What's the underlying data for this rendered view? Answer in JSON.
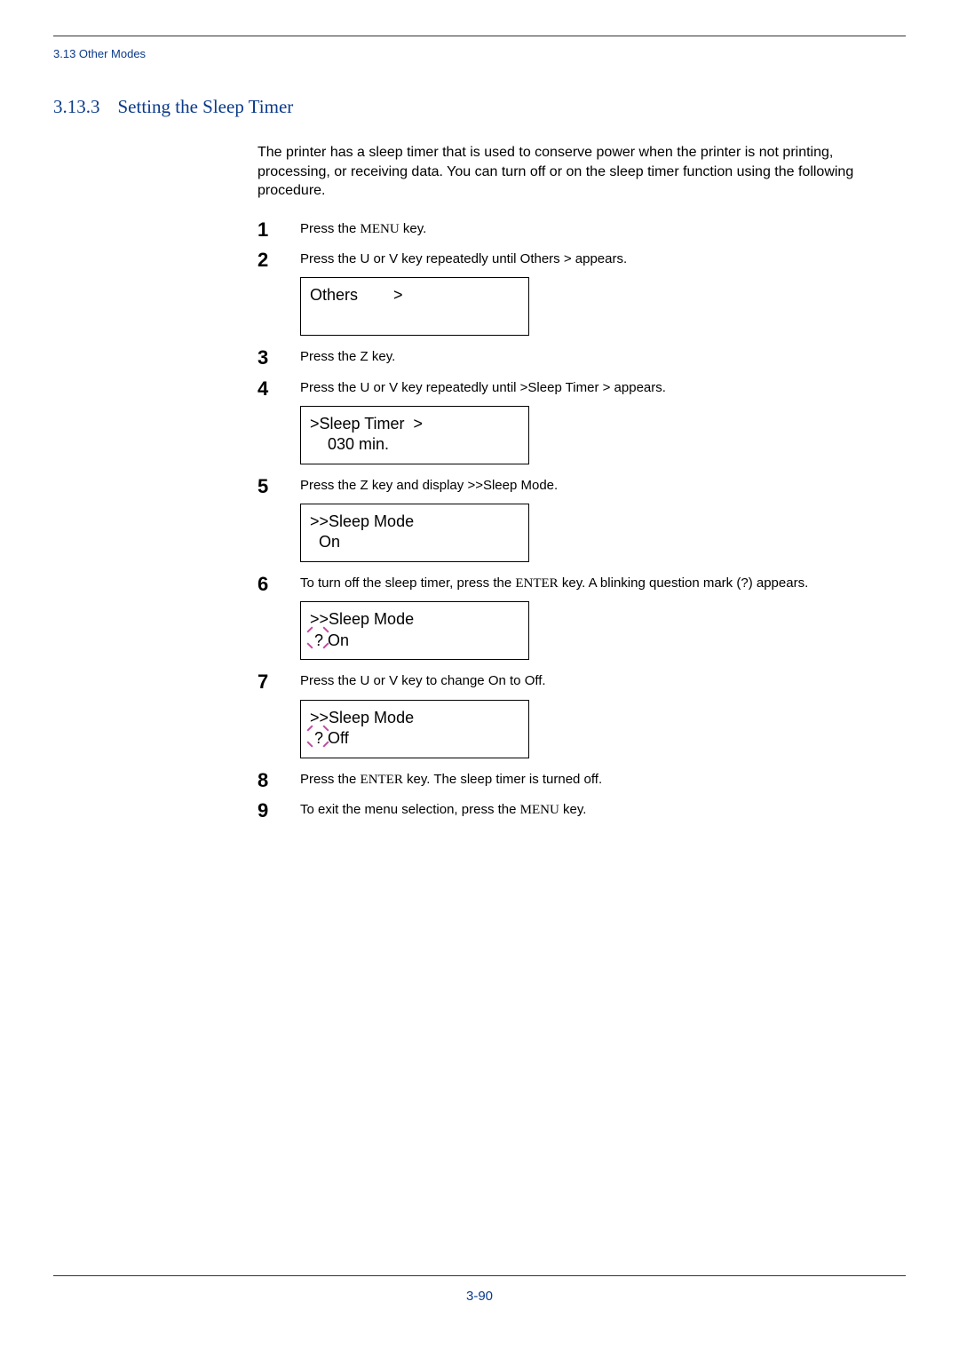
{
  "header": {
    "breadcrumb": "3.13 Other Modes"
  },
  "section": {
    "number": "3.13.3",
    "title": "Setting the Sleep Timer"
  },
  "intro": "The printer has a sleep timer that is used to conserve power when the printer is not printing, processing, or receiving data. You can turn off or on the sleep timer function using the following procedure.",
  "steps": {
    "s1": {
      "num": "1",
      "pre": "Press the ",
      "key": "MENU",
      "post": " key."
    },
    "s2": {
      "num": "2",
      "pre": "Press the ",
      "mid1": "U",
      "mid2": " or ",
      "mid3": "V",
      "mid4": " key repeatedly until ",
      "code": "Others >",
      "post": " appears.",
      "lcd_l1": "Others        >",
      "lcd_l2": ""
    },
    "s3": {
      "num": "3",
      "pre": "Press the ",
      "key": "Z",
      "post": " key."
    },
    "s4": {
      "num": "4",
      "pre": "Press the ",
      "mid1": "U",
      "mid2": " or ",
      "mid3": "V",
      "mid4": " key repeatedly until ",
      "code": ">Sleep Timer >",
      "post": " appears.",
      "lcd_l1": ">Sleep Timer  >",
      "lcd_l2": "    030 min."
    },
    "s5": {
      "num": "5",
      "pre": "Press the ",
      "key": "Z",
      "mid": " key and display ",
      "code": ">>Sleep Mode",
      "post": ".",
      "lcd_l1": ">>Sleep Mode",
      "lcd_l2": "  On"
    },
    "s6": {
      "num": "6",
      "pre": "To turn off the sleep timer, press the ",
      "key": "ENTER",
      "mid": " key. A blinking question mark (",
      "q": "?",
      "post": ") appears.",
      "lcd_l1": ">>Sleep Mode",
      "lcd_l2": " ? On"
    },
    "s7": {
      "num": "7",
      "pre": "Press the ",
      "mid1": "U",
      "mid2": " or ",
      "mid3": "V",
      "mid4": " key to change ",
      "code1": "On",
      "mid5": " to ",
      "code2": "Off",
      "post": ".",
      "lcd_l1": ">>Sleep Mode",
      "lcd_l2": " ? Off"
    },
    "s8": {
      "num": "8",
      "pre": "Press the ",
      "key": "ENTER",
      "post": " key. The sleep timer is turned off."
    },
    "s9": {
      "num": "9",
      "pre": "To exit the menu selection, press the ",
      "key": "MENU",
      "post": " key."
    }
  },
  "footer": {
    "page": "3-90"
  }
}
